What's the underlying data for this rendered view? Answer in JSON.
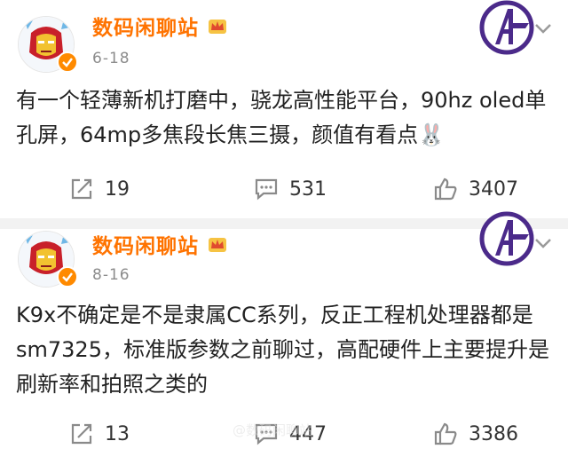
{
  "posts": [
    {
      "author": "数码闲聊站",
      "date": "6-18",
      "text_lines": [
        "有一个轻薄新机打磨中，骁龙高性能平台，90hz oled单",
        "孔屏，64mp多焦段长焦三摄，颜值有看点🐰"
      ],
      "repost_count": "19",
      "comment_count": "531",
      "like_count": "3407"
    },
    {
      "author": "数码闲聊站",
      "date": "8-16",
      "text_lines": [
        "K9x不确定是不是隶属CC系列，反正工程机处理器都是",
        "sm7325，标准版参数之前聊过，高配硬件上主要提升是",
        "刷新率和拍照之类的"
      ],
      "repost_count": "13",
      "comment_count": "447",
      "like_count": "3386"
    }
  ],
  "watermark": "@数码闲聊站",
  "colors": {
    "name": "#ff7300",
    "date": "#8c8c8c",
    "icon": "#8a8a8a",
    "badge": "#4b2a8a",
    "verified": "#ff8a00"
  },
  "icons": {
    "repost": "repost-icon",
    "comment": "comment-icon",
    "like": "thumbs-up-icon",
    "badge": "avengers-badge-icon",
    "crown": "crown-icon",
    "chevron": "chevron-down-icon"
  }
}
